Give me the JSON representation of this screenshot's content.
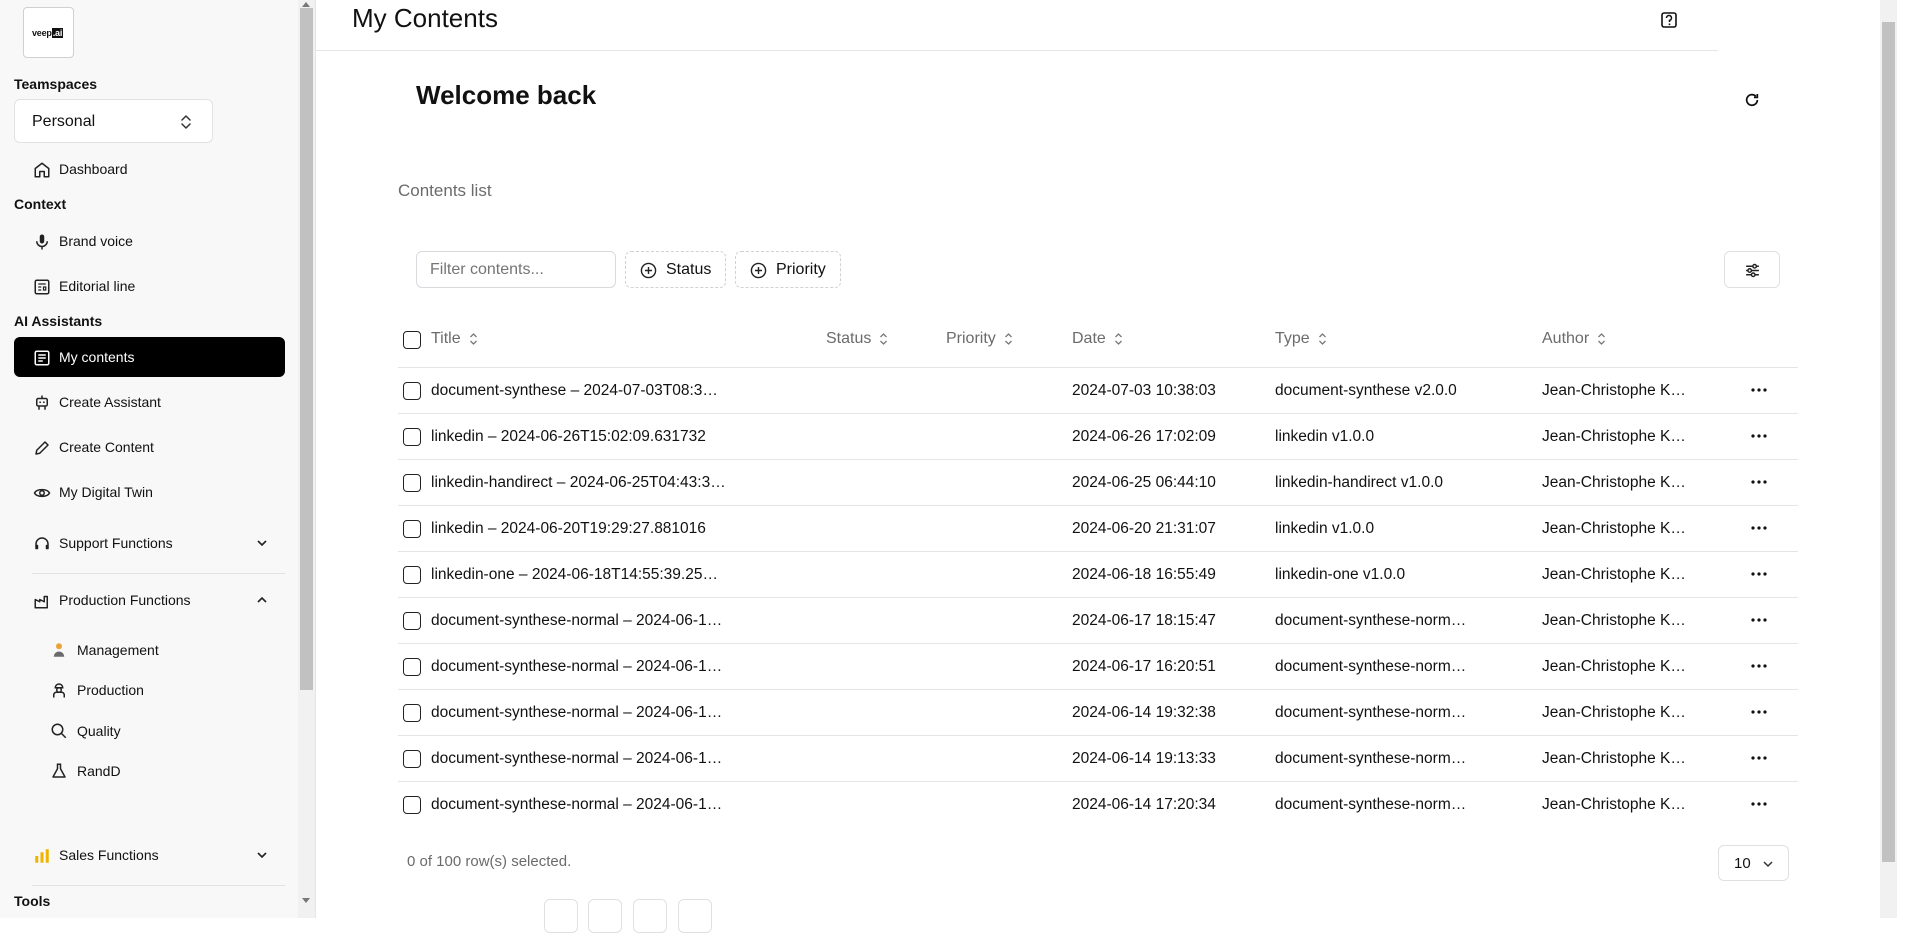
{
  "sidebar": {
    "logo_text_a": "veep",
    "logo_text_b": ".ai",
    "teamspaces_heading": "Teamspaces",
    "teamspace_value": "Personal",
    "dashboard": "Dashboard",
    "context_heading": "Context",
    "brand_voice": "Brand voice",
    "editorial_line": "Editorial line",
    "ai_heading": "AI Assistants",
    "my_contents": "My contents",
    "create_assistant": "Create Assistant",
    "create_content": "Create Content",
    "digital_twin": "My Digital Twin",
    "support_functions": "Support Functions",
    "production_functions": "Production Functions",
    "sub_items": [
      "Management",
      "Production",
      "Quality",
      "RandD"
    ],
    "sales_functions": "Sales Functions",
    "tools_heading": "Tools"
  },
  "header": {
    "title": "My Contents"
  },
  "main": {
    "welcome": "Welcome back",
    "contents_label": "Contents list",
    "filter_placeholder": "Filter contents...",
    "status_chip": "Status",
    "priority_chip": "Priority"
  },
  "table": {
    "columns": [
      "Title",
      "Status",
      "Priority",
      "Date",
      "Type",
      "Author"
    ],
    "rows": [
      {
        "title": "document-synthese – 2024-07-03T08:3…",
        "status": "",
        "priority": "",
        "date": "2024-07-03 10:38:03",
        "type": "document-synthese v2.0.0",
        "author": "Jean-Christophe K…"
      },
      {
        "title": "linkedin – 2024-06-26T15:02:09.631732",
        "status": "",
        "priority": "",
        "date": "2024-06-26 17:02:09",
        "type": "linkedin v1.0.0",
        "author": "Jean-Christophe K…"
      },
      {
        "title": "linkedin-handirect – 2024-06-25T04:43:3…",
        "status": "",
        "priority": "",
        "date": "2024-06-25 06:44:10",
        "type": "linkedin-handirect v1.0.0",
        "author": "Jean-Christophe K…"
      },
      {
        "title": "linkedin – 2024-06-20T19:29:27.881016",
        "status": "",
        "priority": "",
        "date": "2024-06-20 21:31:07",
        "type": "linkedin v1.0.0",
        "author": "Jean-Christophe K…"
      },
      {
        "title": "linkedin-one – 2024-06-18T14:55:39.25…",
        "status": "",
        "priority": "",
        "date": "2024-06-18 16:55:49",
        "type": "linkedin-one v1.0.0",
        "author": "Jean-Christophe K…"
      },
      {
        "title": "document-synthese-normal – 2024-06-1…",
        "status": "",
        "priority": "",
        "date": "2024-06-17 18:15:47",
        "type": "document-synthese-norm…",
        "author": "Jean-Christophe K…"
      },
      {
        "title": "document-synthese-normal – 2024-06-1…",
        "status": "",
        "priority": "",
        "date": "2024-06-17 16:20:51",
        "type": "document-synthese-norm…",
        "author": "Jean-Christophe K…"
      },
      {
        "title": "document-synthese-normal – 2024-06-1…",
        "status": "",
        "priority": "",
        "date": "2024-06-14 19:32:38",
        "type": "document-synthese-norm…",
        "author": "Jean-Christophe K…"
      },
      {
        "title": "document-synthese-normal – 2024-06-1…",
        "status": "",
        "priority": "",
        "date": "2024-06-14 19:13:33",
        "type": "document-synthese-norm…",
        "author": "Jean-Christophe K…"
      },
      {
        "title": "document-synthese-normal – 2024-06-1…",
        "status": "",
        "priority": "",
        "date": "2024-06-14 17:20:34",
        "type": "document-synthese-norm…",
        "author": "Jean-Christophe K…"
      }
    ],
    "selection_text": "0 of 100 row(s) selected.",
    "page_size": "10"
  },
  "icons": {
    "help": "help-icon",
    "refresh": "refresh-icon",
    "view_options": "sliders-icon",
    "row_menu": "more-horizontal-icon",
    "sort": "sort-icon"
  },
  "colors": {
    "active_nav_bg": "#000000",
    "sidebar_bg": "#f8f8f9",
    "accent_management": "#e8a33a",
    "accent_sales": "#f0b400"
  }
}
